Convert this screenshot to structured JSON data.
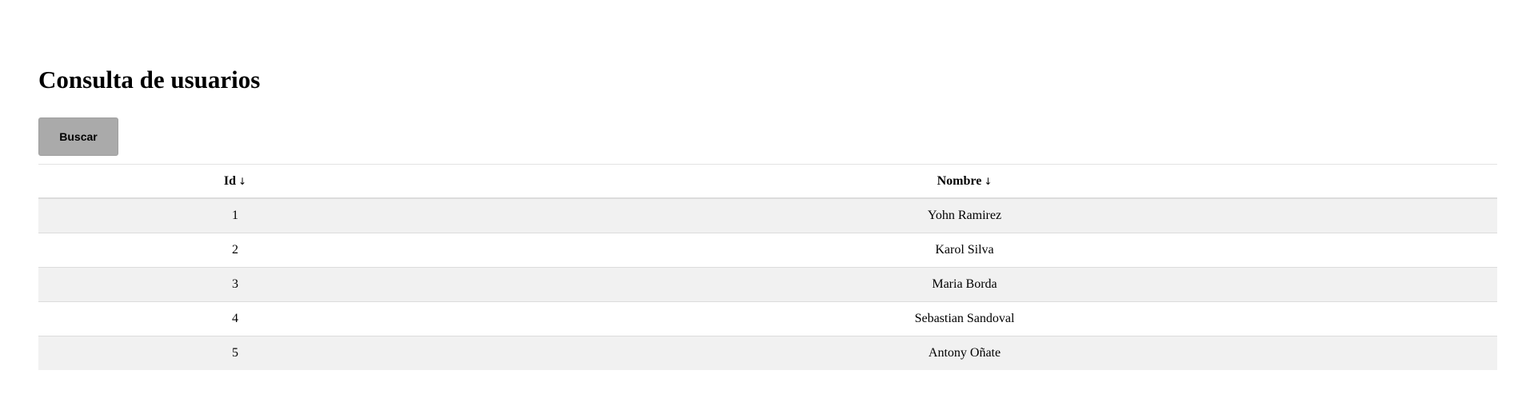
{
  "page": {
    "title": "Consulta de usuarios"
  },
  "toolbar": {
    "search_label": "Buscar"
  },
  "table": {
    "columns": [
      {
        "label": "Id",
        "sort_indicator": "↓"
      },
      {
        "label": "Nombre",
        "sort_indicator": "↓"
      }
    ],
    "rows": [
      {
        "id": "1",
        "name": "Yohn Ramirez"
      },
      {
        "id": "2",
        "name": "Karol Silva"
      },
      {
        "id": "3",
        "name": "Maria Borda"
      },
      {
        "id": "4",
        "name": "Sebastian Sandoval"
      },
      {
        "id": "5",
        "name": "Antony Oñate"
      }
    ]
  },
  "colors": {
    "button_background": "#aaaaaa",
    "row_stripe": "#f1f1f1",
    "divider": "#dcdcdc"
  }
}
